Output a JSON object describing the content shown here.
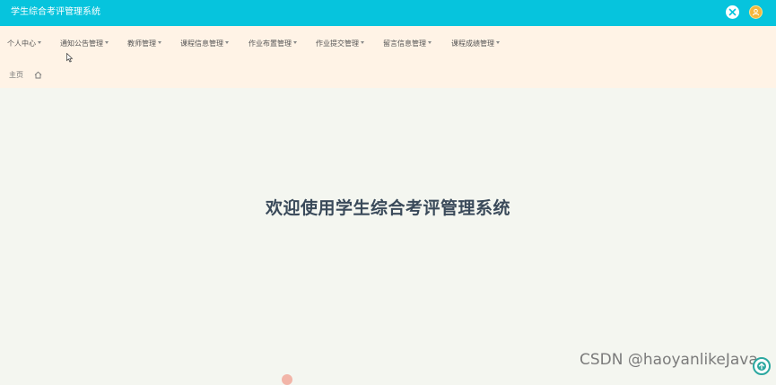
{
  "header": {
    "app_title": "学生综合考评管理系统"
  },
  "nav": {
    "items": [
      {
        "label": "个人中心"
      },
      {
        "label": "通知公告管理"
      },
      {
        "label": "教师管理"
      },
      {
        "label": "课程信息管理"
      },
      {
        "label": "作业布置管理"
      },
      {
        "label": "作业提交管理"
      },
      {
        "label": "留言信息管理"
      },
      {
        "label": "课程成绩管理"
      }
    ]
  },
  "breadcrumb": {
    "home_label": "主页"
  },
  "main": {
    "welcome_text": "欢迎使用学生综合考评管理系统"
  },
  "watermark": {
    "text": "CSDN @haoyanlikeJava"
  },
  "colors": {
    "header_bg": "#06c4dd",
    "nav_bg": "#fff3e6",
    "page_bg": "#f4f6f0",
    "avatar": "#f6b73c"
  },
  "icons": {
    "close": "close-icon",
    "avatar": "user-avatar-icon",
    "home": "home-icon",
    "scroll_top": "arrow-up-icon"
  }
}
